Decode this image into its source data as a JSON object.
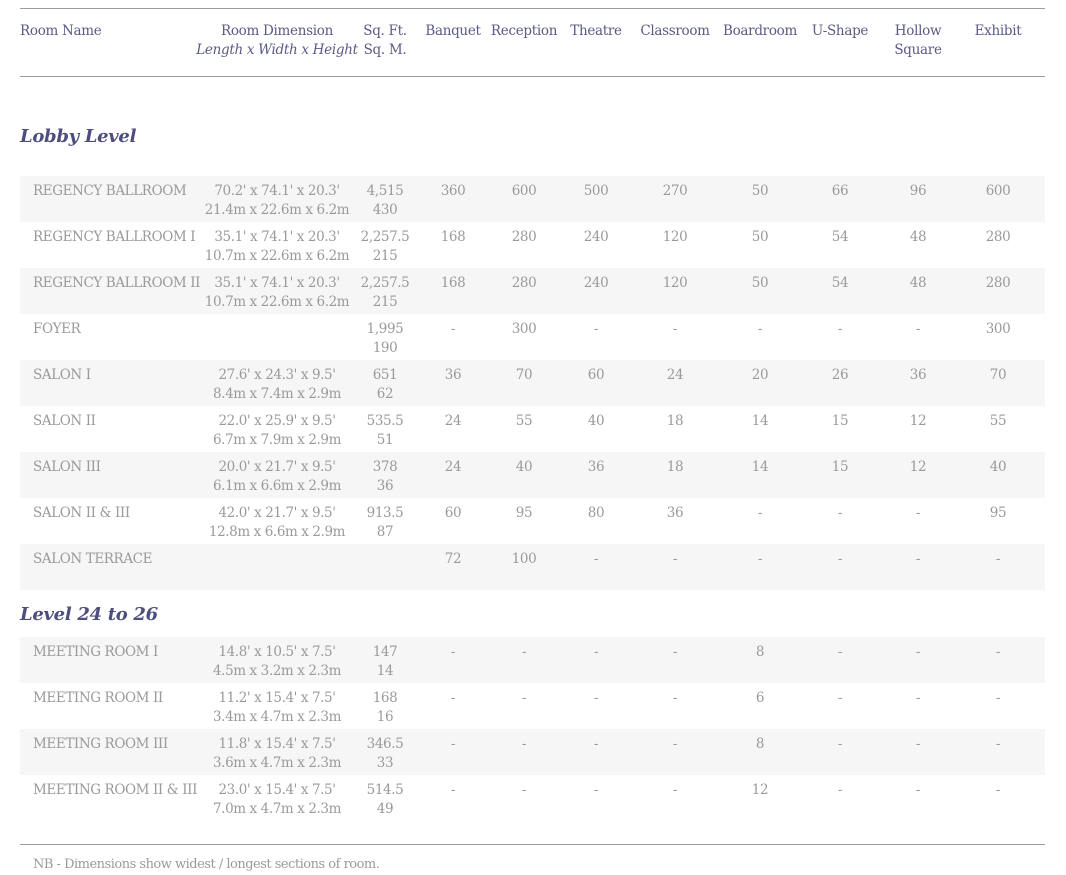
{
  "headers": {
    "room_name": "Room Name",
    "room_dimension": "Room Dimension",
    "room_dimension_sub": "Length x Width x Height",
    "sqft": "Sq. Ft.",
    "sqm": "Sq. M.",
    "banquet": "Banquet",
    "reception": "Reception",
    "theatre": "Theatre",
    "classroom": "Classroom",
    "boardroom": "Boardroom",
    "ushape": "U-Shape",
    "hollow_1": "Hollow",
    "hollow_2": "Square",
    "exhibit": "Exhibit"
  },
  "sections": [
    {
      "title": "Lobby Level",
      "rows": [
        {
          "name": "REGENCY BALLROOM",
          "dim_ft": "70.2' x 74.1' x 20.3'",
          "dim_m": "21.4m x 22.6m x 6.2m",
          "sqft": "4,515",
          "sqm": "430",
          "banquet": "360",
          "reception": "600",
          "theatre": "500",
          "classroom": "270",
          "boardroom": "50",
          "ushape": "66",
          "hollow": "96",
          "exhibit": "600"
        },
        {
          "name": "REGENCY BALLROOM I",
          "dim_ft": "35.1' x 74.1' x 20.3'",
          "dim_m": "10.7m x 22.6m x 6.2m",
          "sqft": "2,257.5",
          "sqm": "215",
          "banquet": "168",
          "reception": "280",
          "theatre": "240",
          "classroom": "120",
          "boardroom": "50",
          "ushape": "54",
          "hollow": "48",
          "exhibit": "280"
        },
        {
          "name": "REGENCY BALLROOM II",
          "dim_ft": "35.1' x 74.1' x 20.3'",
          "dim_m": "10.7m x 22.6m x 6.2m",
          "sqft": "2,257.5",
          "sqm": "215",
          "banquet": "168",
          "reception": "280",
          "theatre": "240",
          "classroom": "120",
          "boardroom": "50",
          "ushape": "54",
          "hollow": "48",
          "exhibit": "280"
        },
        {
          "name": "FOYER",
          "dim_ft": "",
          "dim_m": "",
          "sqft": "1,995",
          "sqm": "190",
          "banquet": "-",
          "reception": "300",
          "theatre": "-",
          "classroom": "-",
          "boardroom": "-",
          "ushape": "-",
          "hollow": "-",
          "exhibit": "300"
        },
        {
          "name": "SALON I",
          "dim_ft": "27.6' x 24.3' x 9.5'",
          "dim_m": "8.4m x 7.4m x 2.9m",
          "sqft": "651",
          "sqm": "62",
          "banquet": "36",
          "reception": "70",
          "theatre": "60",
          "classroom": "24",
          "boardroom": "20",
          "ushape": "26",
          "hollow": "36",
          "exhibit": "70"
        },
        {
          "name": "SALON II",
          "dim_ft": "22.0' x 25.9' x 9.5'",
          "dim_m": "6.7m x 7.9m x 2.9m",
          "sqft": "535.5",
          "sqm": "51",
          "banquet": "24",
          "reception": "55",
          "theatre": "40",
          "classroom": "18",
          "boardroom": "14",
          "ushape": "15",
          "hollow": "12",
          "exhibit": "55"
        },
        {
          "name": "SALON III",
          "dim_ft": "20.0' x 21.7' x 9.5'",
          "dim_m": "6.1m x 6.6m x 2.9m",
          "sqft": "378",
          "sqm": "36",
          "banquet": "24",
          "reception": "40",
          "theatre": "36",
          "classroom": "18",
          "boardroom": "14",
          "ushape": "15",
          "hollow": "12",
          "exhibit": "40"
        },
        {
          "name": "SALON II & III",
          "dim_ft": "42.0' x 21.7' x 9.5'",
          "dim_m": "12.8m x 6.6m x 2.9m",
          "sqft": "913.5",
          "sqm": "87",
          "banquet": "60",
          "reception": "95",
          "theatre": "80",
          "classroom": "36",
          "boardroom": "-",
          "ushape": "-",
          "hollow": "-",
          "exhibit": "95"
        },
        {
          "name": "SALON TERRACE",
          "dim_ft": "",
          "dim_m": "",
          "sqft": "",
          "sqm": "",
          "banquet": "72",
          "reception": "100",
          "theatre": "-",
          "classroom": "-",
          "boardroom": "-",
          "ushape": "-",
          "hollow": "-",
          "exhibit": "-"
        }
      ]
    },
    {
      "title": "Level 24 to 26",
      "rows": [
        {
          "name": "MEETING ROOM I",
          "dim_ft": "14.8' x 10.5' x 7.5'",
          "dim_m": "4.5m x 3.2m x 2.3m",
          "sqft": "147",
          "sqm": "14",
          "banquet": "-",
          "reception": "-",
          "theatre": "-",
          "classroom": "-",
          "boardroom": "8",
          "ushape": "-",
          "hollow": "-",
          "exhibit": "-"
        },
        {
          "name": "MEETING ROOM II",
          "dim_ft": "11.2' x 15.4' x 7.5'",
          "dim_m": "3.4m x 4.7m x 2.3m",
          "sqft": "168",
          "sqm": "16",
          "banquet": "-",
          "reception": "-",
          "theatre": "-",
          "classroom": "-",
          "boardroom": "6",
          "ushape": "-",
          "hollow": "-",
          "exhibit": "-"
        },
        {
          "name": "MEETING ROOM III",
          "dim_ft": "11.8' x 15.4' x 7.5'",
          "dim_m": "3.6m x 4.7m x 2.3m",
          "sqft": "346.5",
          "sqm": "33",
          "banquet": "-",
          "reception": "-",
          "theatre": "-",
          "classroom": "-",
          "boardroom": "8",
          "ushape": "-",
          "hollow": "-",
          "exhibit": "-"
        },
        {
          "name": "MEETING ROOM II & III",
          "dim_ft": "23.0' x 15.4' x 7.5'",
          "dim_m": "7.0m x 4.7m x 2.3m",
          "sqft": "514.5",
          "sqm": "49",
          "banquet": "-",
          "reception": "-",
          "theatre": "-",
          "classroom": "-",
          "boardroom": "12",
          "ushape": "-",
          "hollow": "-",
          "exhibit": "-"
        }
      ]
    }
  ],
  "footnote": "NB - Dimensions show widest / longest sections of room."
}
